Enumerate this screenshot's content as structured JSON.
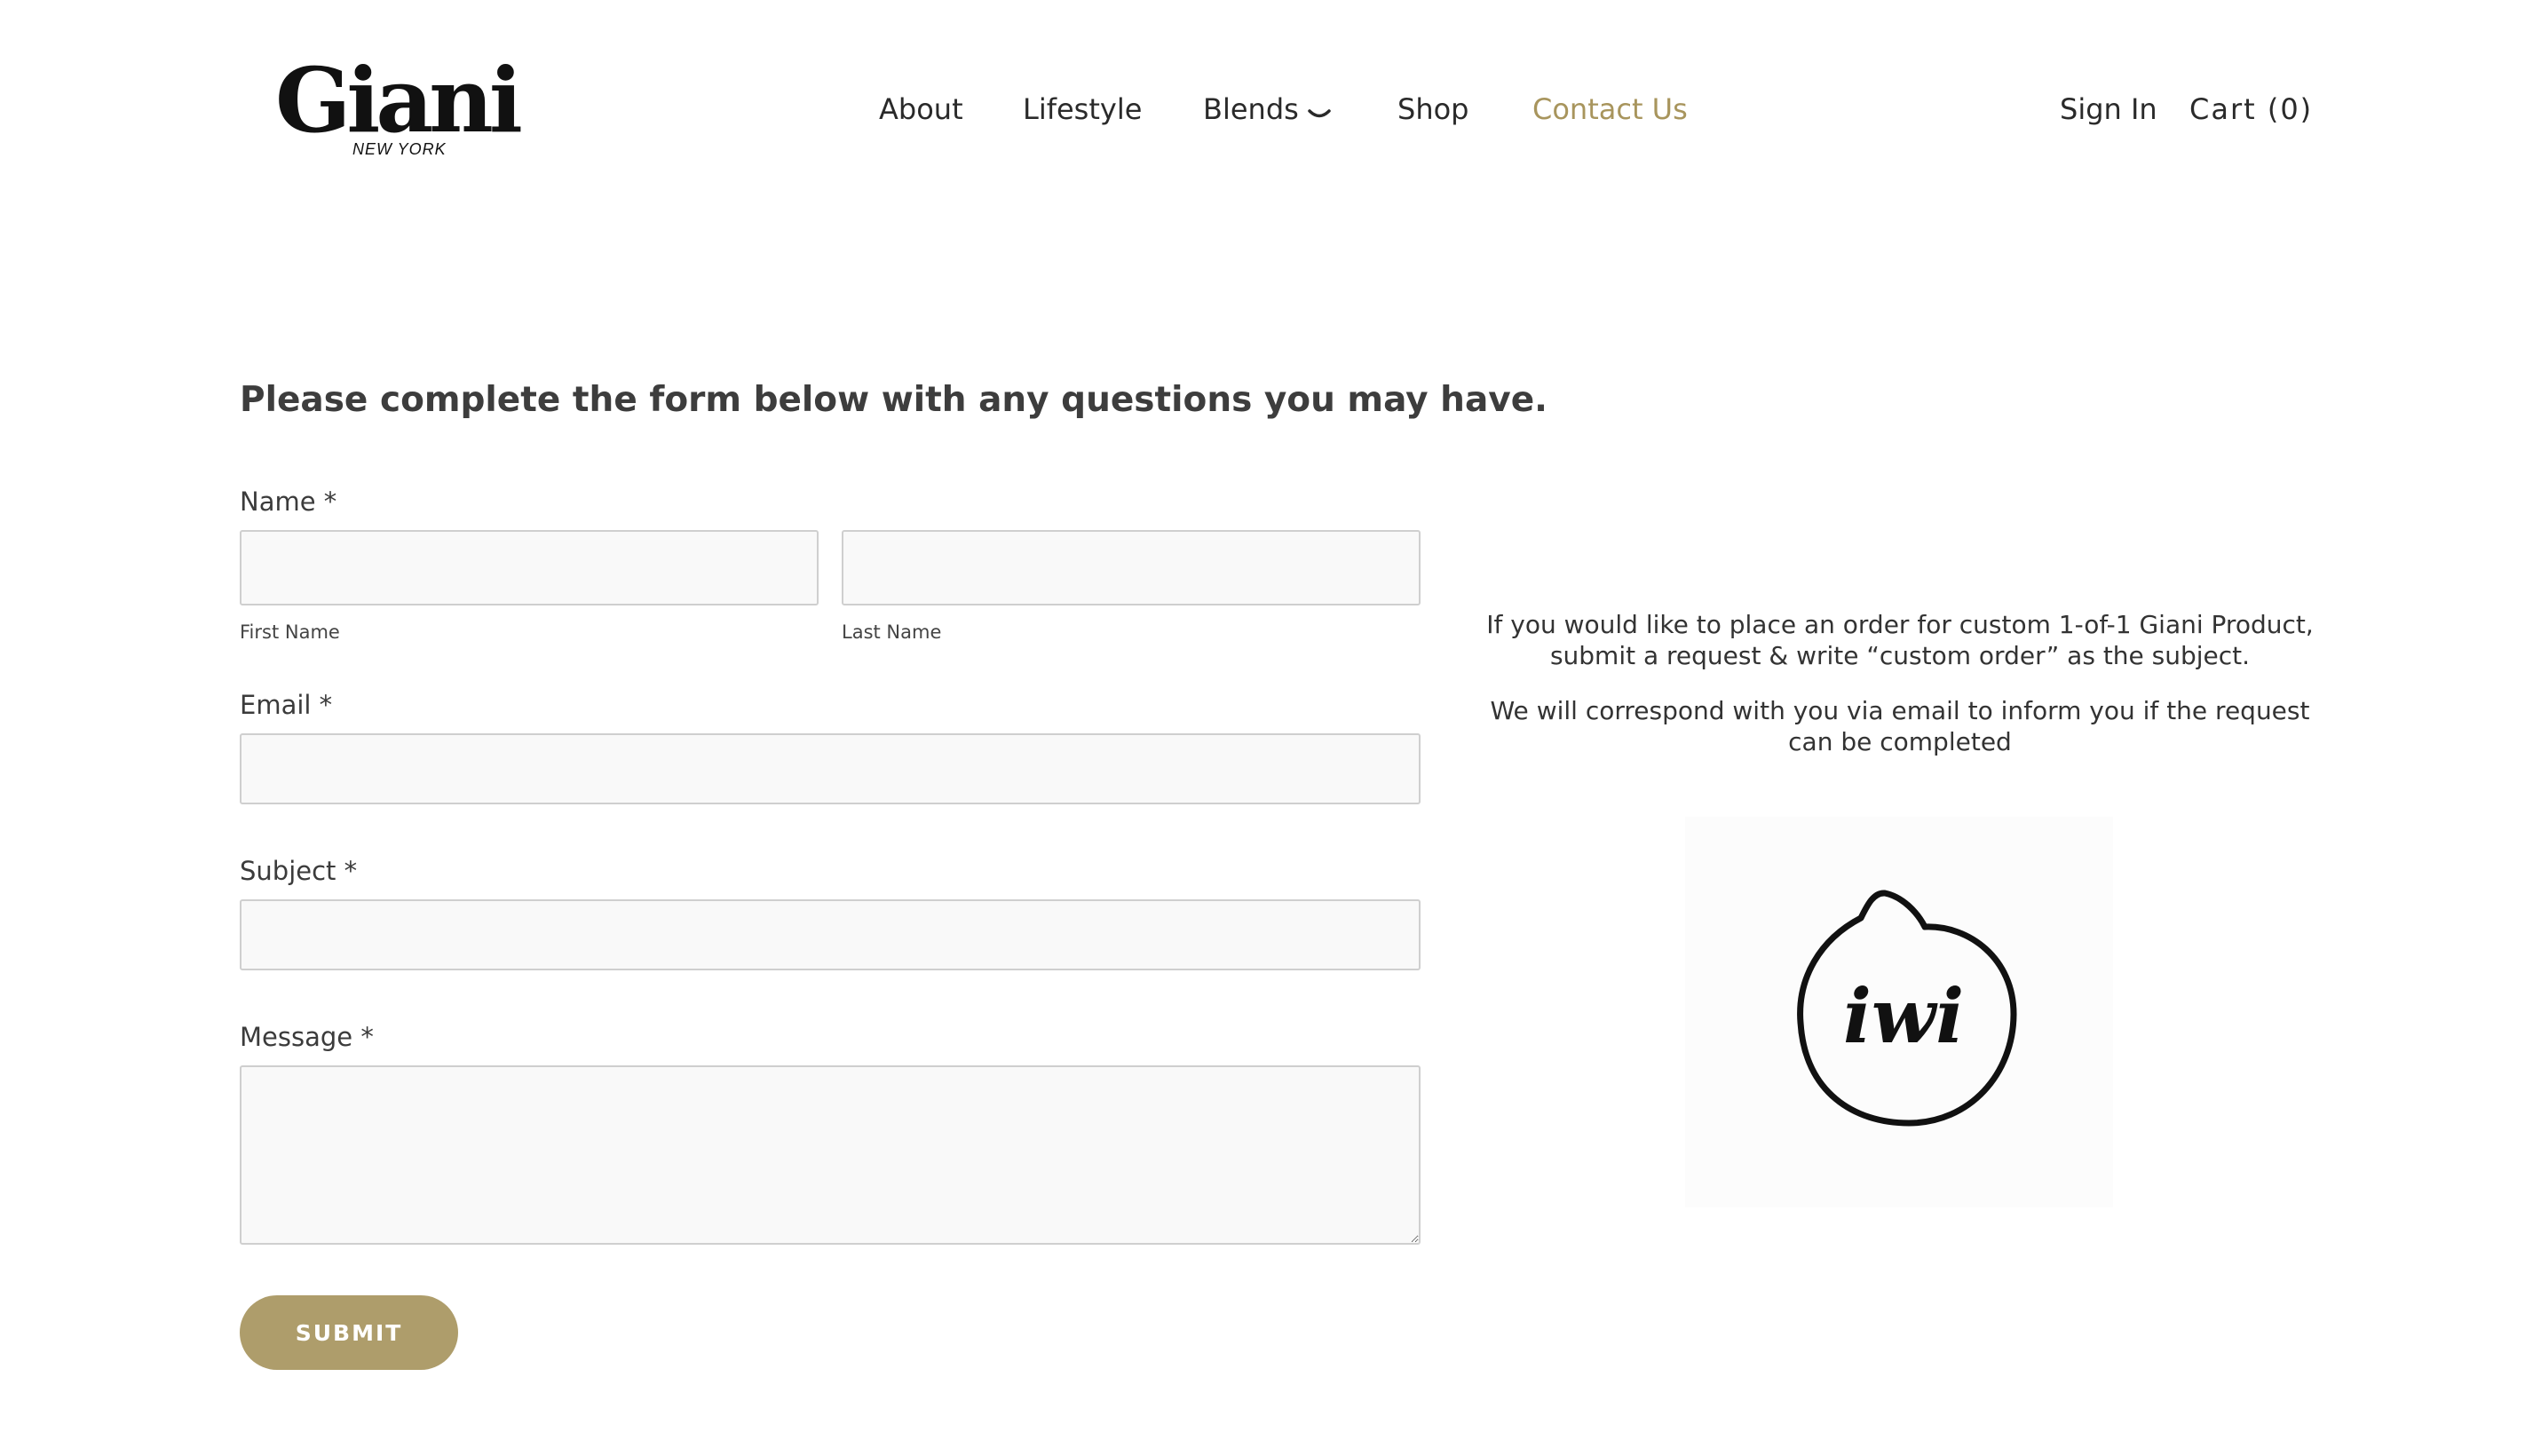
{
  "header": {
    "logo": {
      "name": "Giani",
      "tagline": "NEW YORK"
    },
    "nav": [
      {
        "label": "About"
      },
      {
        "label": "Lifestyle"
      },
      {
        "label": "Blends"
      },
      {
        "label": "Shop"
      },
      {
        "label": "Contact Us",
        "active": true
      }
    ],
    "sign_in": "Sign In",
    "cart": "Cart (0)",
    "accent_color": "#a8955d"
  },
  "form": {
    "heading": "Please complete the form below with any questions you may have.",
    "name_label": "Name *",
    "first_name_sublabel": "First Name",
    "last_name_sublabel": "Last Name",
    "first_name_value": "",
    "last_name_value": "",
    "email_label": "Email *",
    "email_value": "",
    "subject_label": "Subject *",
    "subject_value": "",
    "message_label": "Message *",
    "message_value": "",
    "submit_label": "SUBMIT",
    "submit_color": "#ae9d6b"
  },
  "info": {
    "paragraph1_line1": "If you would like to place an order for custom 1-of-1 Giani Product,",
    "paragraph1_line2": "submit a request & write “custom order” as the subject.",
    "paragraph2_line1": "We will correspond with you via email to inform you if the request",
    "paragraph2_line2": "can be completed",
    "emblem_text": "iwi"
  },
  "icons": {
    "dropdown": "chevron-down-icon",
    "emblem": "speech-bubble-emblem-icon"
  }
}
